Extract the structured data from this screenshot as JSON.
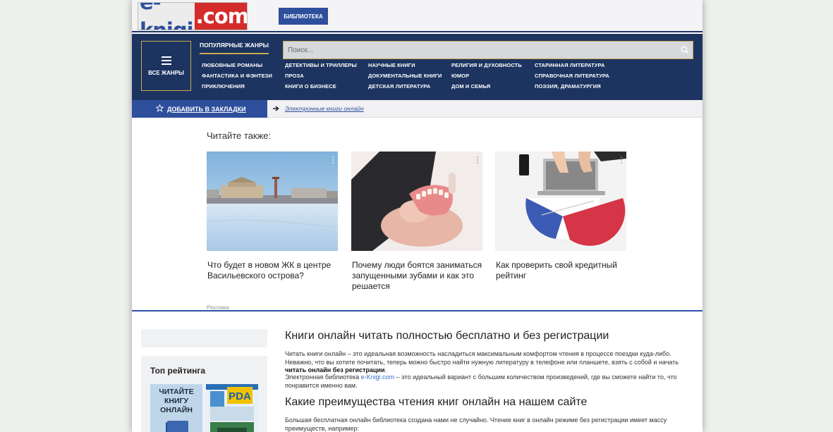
{
  "header": {
    "logo_left": "e-knigi",
    "logo_right": ".com",
    "library_button": "БИБЛИОТЕКА"
  },
  "nav": {
    "all_genres": "ВСЕ ЖАНРЫ",
    "popular": "ПОПУЛЯРНЫЕ ЖАНРЫ",
    "search_placeholder": "Поиск...",
    "genres": [
      "ЛЮБОВНЫЕ РОМАНЫ",
      "ДЕТЕКТИВЫ И ТРИЛЛЕРЫ",
      "НАУЧНЫЕ КНИГИ",
      "РЕЛИГИЯ И ДУХОВНОСТЬ",
      "СТАРИННАЯ ЛИТЕРАТУРА",
      "ФАНТАСТИКА И ФЭНТЕЗИ",
      "ПРОЗА",
      "ДОКУМЕНТАЛЬНЫЕ КНИГИ",
      "ЮМОР",
      "СПРАВОЧНАЯ ЛИТЕРАТУРА",
      "ПРИКЛЮЧЕНИЯ",
      "КНИГИ О БИЗНЕСЕ",
      "ДЕТСКАЯ ЛИТЕРАТУРА",
      "ДОМ И СЕМЬЯ",
      "ПОЭЗИЯ, ДРАМАТУРГИЯ"
    ]
  },
  "bookmark": {
    "label": "ДОБАВИТЬ В ЗАКЛАДКИ",
    "breadcrumb": "Электронные книги онлайн"
  },
  "ads": {
    "heading": "Читайте также:",
    "cards": [
      {
        "title": "Что будет в новом ЖК в центре Васильевского острова?"
      },
      {
        "title": "Почему люди боятся заниматься запущенными зубами и как это решается"
      },
      {
        "title": "Как проверить свой кредитный рейтинг"
      }
    ],
    "ad_label": "Реклама"
  },
  "sidebar": {
    "top_title": "Топ рейтинга",
    "books": [
      {
        "cover_text": "ЧИТАЙТЕ КНИГУ ОНЛАЙН"
      },
      {
        "cover_text": "PDA"
      }
    ]
  },
  "article": {
    "h1": "Книги онлайн читать полностью бесплатно и без регистрации",
    "p1_a": "Читать книги онлайн – это идеальная возможность насладиться максимальным комфортом чтения в процессе поездки куда-либо. Неважно, что вы хотите почитать, теперь можно быстро найти нужную литературу в телефоне или планшете, взять с собой и начать ",
    "p1_b": "читать онлайн без регистрации",
    "p1_c": ".",
    "p2_a": "Электронная библиотека ",
    "p2_link": "e-Knigi.com",
    "p2_b": " – это идеальный вариант с большим количеством произведений, где вы сможете найти то, что понравится именно вам.",
    "h2": "Какие преимущества чтения книг онлайн на нашем сайте",
    "p3": "Большая бесплатная онлайн библиотека создана нами не случайно. Чтение книг в онлайн режиме без регистрации имеет массу преимуществ, например:"
  },
  "colors": {
    "nav_bg": "#1d3461",
    "accent_blue": "#2d4f9c",
    "gold": "#c9a94a",
    "logo_red": "#d42b2b"
  }
}
